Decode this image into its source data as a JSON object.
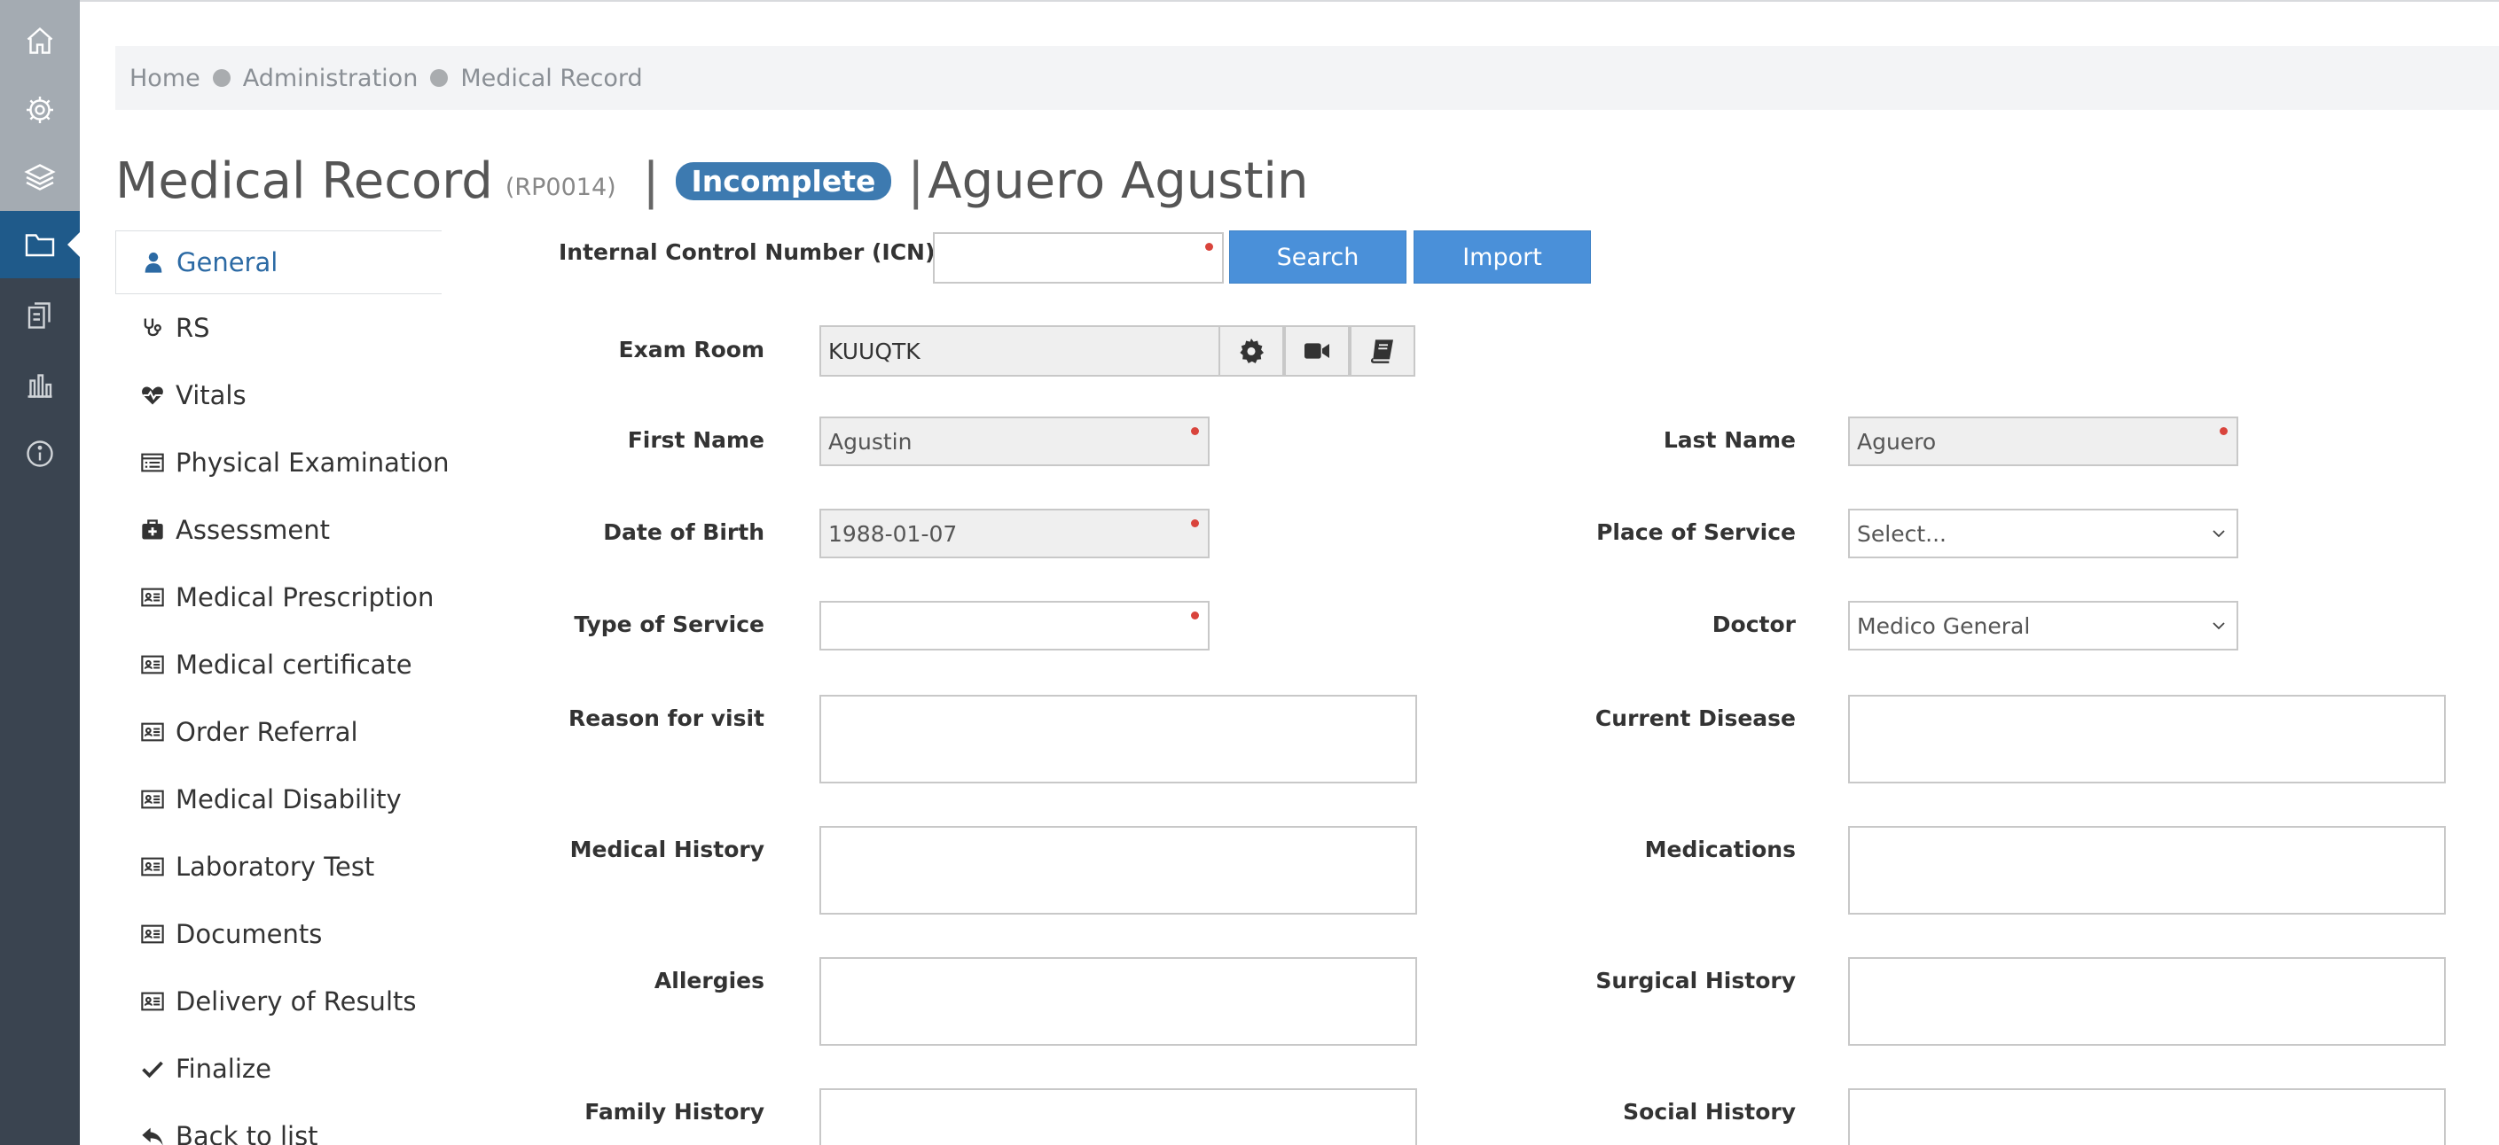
{
  "breadcrumb": [
    "Home",
    "Administration",
    "Medical Record"
  ],
  "title": {
    "main": "Medical Record",
    "code": "(RP0014)",
    "separator": "|",
    "status": "Incomplete",
    "patient": "Aguero Agustin"
  },
  "nav": [
    {
      "label": "General",
      "icon": "user-icon",
      "active": true
    },
    {
      "label": "RS",
      "icon": "stethoscope-icon"
    },
    {
      "label": "Vitals",
      "icon": "heartbeat-icon"
    },
    {
      "label": "Physical Examination",
      "icon": "list-alt-icon"
    },
    {
      "label": "Assessment",
      "icon": "medkit-icon"
    },
    {
      "label": "Medical Prescription",
      "icon": "id-card-icon"
    },
    {
      "label": "Medical certificate",
      "icon": "id-card-icon"
    },
    {
      "label": "Order Referral",
      "icon": "id-card-icon"
    },
    {
      "label": "Medical Disability",
      "icon": "id-card-icon"
    },
    {
      "label": "Laboratory Test",
      "icon": "id-card-icon"
    },
    {
      "label": "Documents",
      "icon": "id-card-icon"
    },
    {
      "label": "Delivery of Results",
      "icon": "id-card-icon"
    },
    {
      "label": "Finalize",
      "icon": "check-icon"
    },
    {
      "label": "Back to list",
      "icon": "reply-icon"
    }
  ],
  "rail_icons": [
    "home-icon",
    "gear-icon",
    "layers-icon",
    "folder-icon",
    "copy-icon",
    "bar-chart-icon",
    "info-icon"
  ],
  "form": {
    "icn": {
      "label": "Internal Control Number (ICN)",
      "value": ""
    },
    "search_label": "Search",
    "import_label": "Import",
    "exam_room": {
      "label": "Exam Room",
      "value": "KUUQTK"
    },
    "first_name": {
      "label": "First Name",
      "value": "Agustin"
    },
    "last_name": {
      "label": "Last Name",
      "value": "Aguero"
    },
    "dob": {
      "label": "Date of Birth",
      "value": "1988-01-07"
    },
    "place_of_service": {
      "label": "Place of Service",
      "value": "Select..."
    },
    "type_of_service": {
      "label": "Type of Service",
      "value": ""
    },
    "doctor": {
      "label": "Doctor",
      "value": "Medico General"
    },
    "reason": {
      "label": "Reason for visit"
    },
    "current_disease": {
      "label": "Current Disease"
    },
    "medical_history": {
      "label": "Medical History"
    },
    "medications": {
      "label": "Medications"
    },
    "allergies": {
      "label": "Allergies"
    },
    "surgical_history": {
      "label": "Surgical History"
    },
    "family_history": {
      "label": "Family History"
    },
    "social_history": {
      "label": "Social History"
    }
  },
  "colors": {
    "accent": "#4a90d9",
    "badge": "#3d7ab0",
    "rail": "#3a4450",
    "required": "#d9443c"
  }
}
